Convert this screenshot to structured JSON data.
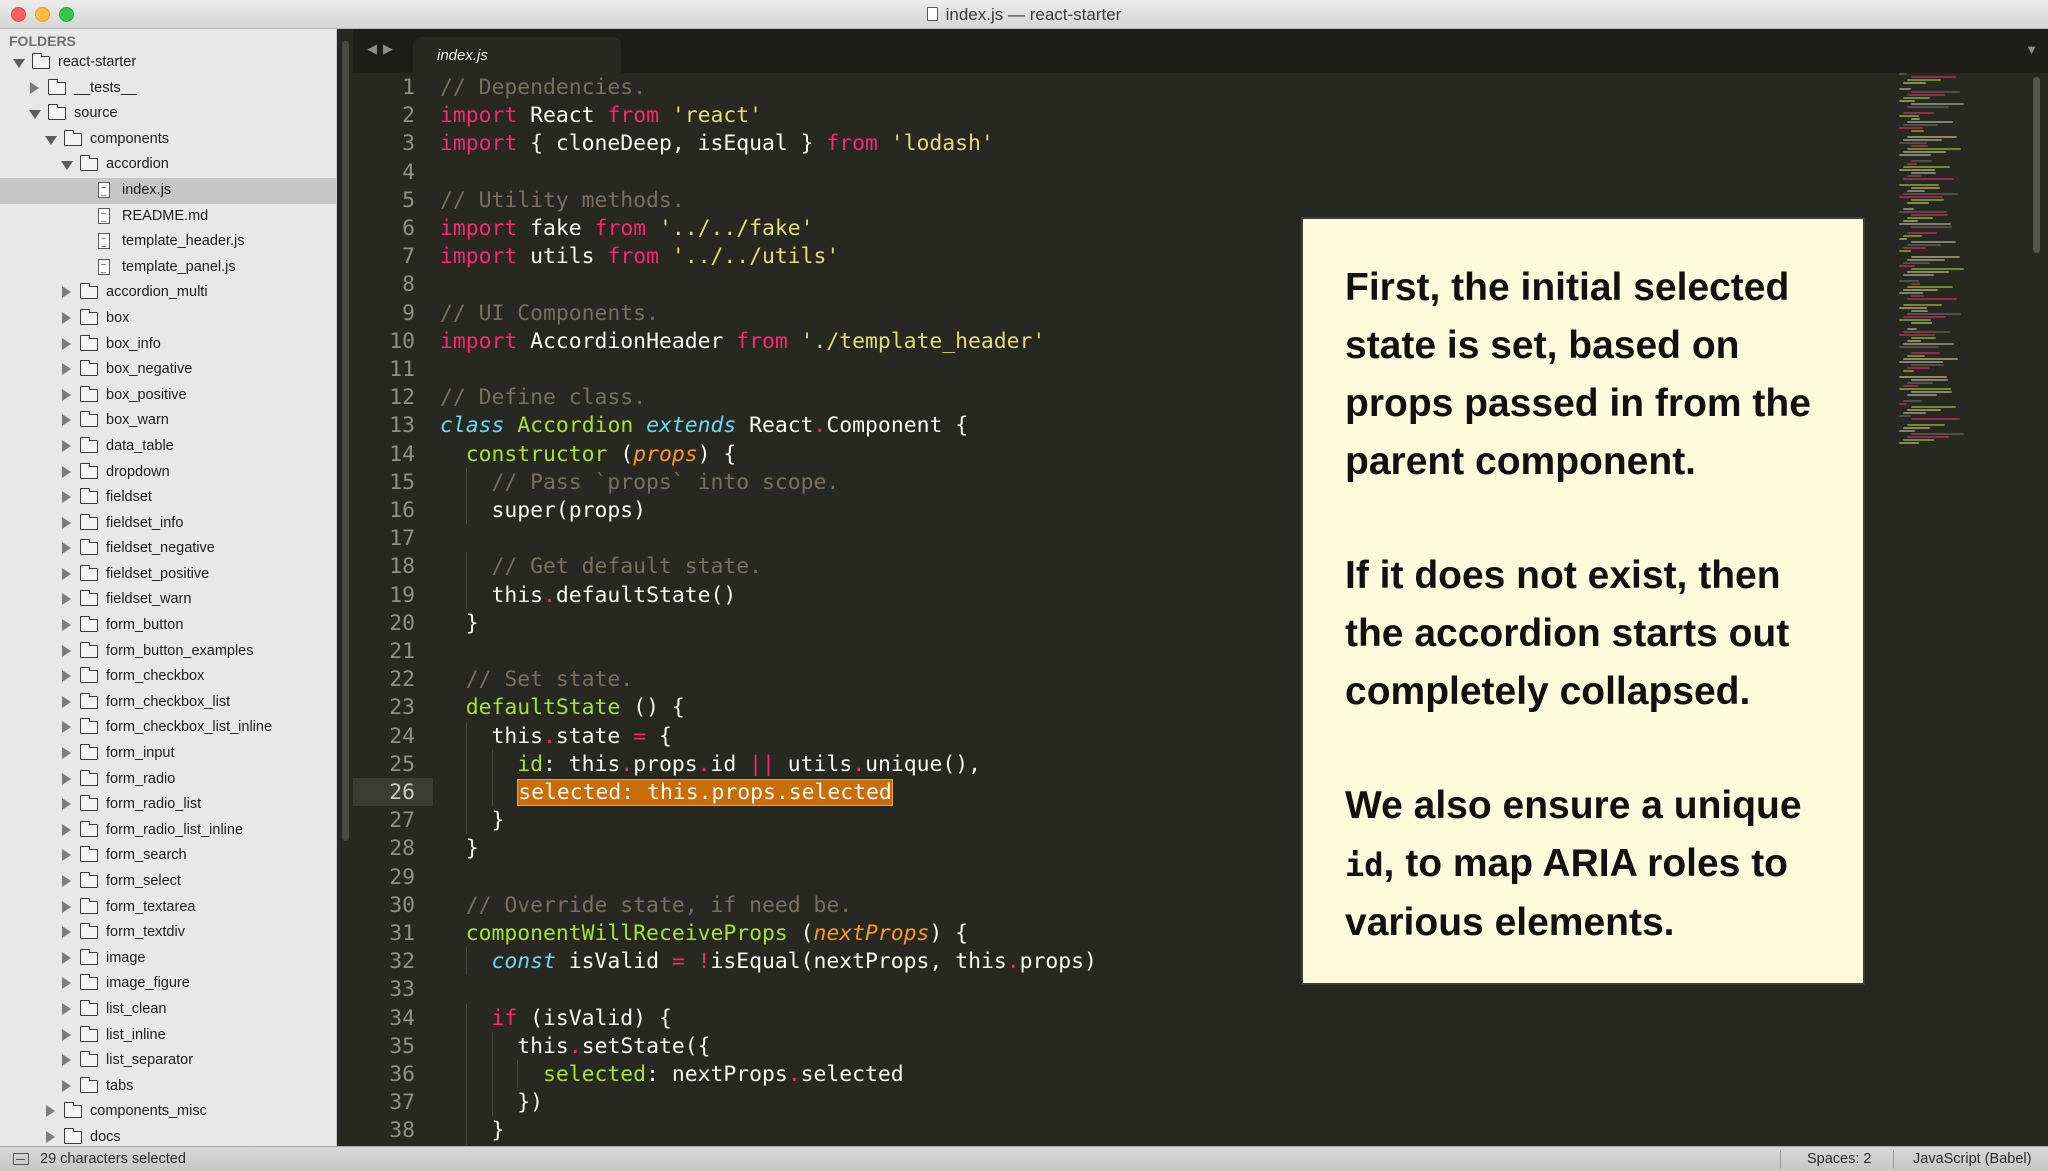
{
  "window": {
    "title": "index.js — react-starter",
    "controls": [
      "close-icon",
      "minimize-icon",
      "maximize-icon"
    ]
  },
  "sidebar": {
    "heading": "FOLDERS",
    "tree": [
      {
        "label": "react-starter",
        "depth": 0,
        "type": "folder",
        "expanded": true
      },
      {
        "label": "__tests__",
        "depth": 1,
        "type": "folder",
        "expanded": false
      },
      {
        "label": "source",
        "depth": 1,
        "type": "folder",
        "expanded": true
      },
      {
        "label": "components",
        "depth": 2,
        "type": "folder",
        "expanded": true
      },
      {
        "label": "accordion",
        "depth": 3,
        "type": "folder",
        "expanded": true
      },
      {
        "label": "index.js",
        "depth": 4,
        "type": "file",
        "selected": true
      },
      {
        "label": "README.md",
        "depth": 4,
        "type": "file"
      },
      {
        "label": "template_header.js",
        "depth": 4,
        "type": "file"
      },
      {
        "label": "template_panel.js",
        "depth": 4,
        "type": "file"
      },
      {
        "label": "accordion_multi",
        "depth": 3,
        "type": "folder",
        "expanded": false
      },
      {
        "label": "box",
        "depth": 3,
        "type": "folder",
        "expanded": false
      },
      {
        "label": "box_info",
        "depth": 3,
        "type": "folder",
        "expanded": false
      },
      {
        "label": "box_negative",
        "depth": 3,
        "type": "folder",
        "expanded": false
      },
      {
        "label": "box_positive",
        "depth": 3,
        "type": "folder",
        "expanded": false
      },
      {
        "label": "box_warn",
        "depth": 3,
        "type": "folder",
        "expanded": false
      },
      {
        "label": "data_table",
        "depth": 3,
        "type": "folder",
        "expanded": false
      },
      {
        "label": "dropdown",
        "depth": 3,
        "type": "folder",
        "expanded": false
      },
      {
        "label": "fieldset",
        "depth": 3,
        "type": "folder",
        "expanded": false
      },
      {
        "label": "fieldset_info",
        "depth": 3,
        "type": "folder",
        "expanded": false
      },
      {
        "label": "fieldset_negative",
        "depth": 3,
        "type": "folder",
        "expanded": false
      },
      {
        "label": "fieldset_positive",
        "depth": 3,
        "type": "folder",
        "expanded": false
      },
      {
        "label": "fieldset_warn",
        "depth": 3,
        "type": "folder",
        "expanded": false
      },
      {
        "label": "form_button",
        "depth": 3,
        "type": "folder",
        "expanded": false
      },
      {
        "label": "form_button_examples",
        "depth": 3,
        "type": "folder",
        "expanded": false
      },
      {
        "label": "form_checkbox",
        "depth": 3,
        "type": "folder",
        "expanded": false
      },
      {
        "label": "form_checkbox_list",
        "depth": 3,
        "type": "folder",
        "expanded": false
      },
      {
        "label": "form_checkbox_list_inline",
        "depth": 3,
        "type": "folder",
        "expanded": false
      },
      {
        "label": "form_input",
        "depth": 3,
        "type": "folder",
        "expanded": false
      },
      {
        "label": "form_radio",
        "depth": 3,
        "type": "folder",
        "expanded": false
      },
      {
        "label": "form_radio_list",
        "depth": 3,
        "type": "folder",
        "expanded": false
      },
      {
        "label": "form_radio_list_inline",
        "depth": 3,
        "type": "folder",
        "expanded": false
      },
      {
        "label": "form_search",
        "depth": 3,
        "type": "folder",
        "expanded": false
      },
      {
        "label": "form_select",
        "depth": 3,
        "type": "folder",
        "expanded": false
      },
      {
        "label": "form_textarea",
        "depth": 3,
        "type": "folder",
        "expanded": false
      },
      {
        "label": "form_textdiv",
        "depth": 3,
        "type": "folder",
        "expanded": false
      },
      {
        "label": "image",
        "depth": 3,
        "type": "folder",
        "expanded": false
      },
      {
        "label": "image_figure",
        "depth": 3,
        "type": "folder",
        "expanded": false
      },
      {
        "label": "list_clean",
        "depth": 3,
        "type": "folder",
        "expanded": false
      },
      {
        "label": "list_inline",
        "depth": 3,
        "type": "folder",
        "expanded": false
      },
      {
        "label": "list_separator",
        "depth": 3,
        "type": "folder",
        "expanded": false
      },
      {
        "label": "tabs",
        "depth": 3,
        "type": "folder",
        "expanded": false
      },
      {
        "label": "components_misc",
        "depth": 2,
        "type": "folder",
        "expanded": false
      },
      {
        "label": "docs",
        "depth": 2,
        "type": "folder",
        "expanded": false
      }
    ]
  },
  "tabs": [
    {
      "label": "index.js",
      "active": true
    }
  ],
  "editor": {
    "active_line": 26,
    "lines": [
      [
        [
          "c",
          "// Dependencies."
        ]
      ],
      [
        [
          "k",
          "import"
        ],
        [
          "p",
          " React "
        ],
        [
          "k",
          "from"
        ],
        [
          "p",
          " "
        ],
        [
          "s",
          "'react'"
        ]
      ],
      [
        [
          "k",
          "import"
        ],
        [
          "p",
          " { cloneDeep, isEqual } "
        ],
        [
          "k",
          "from"
        ],
        [
          "p",
          " "
        ],
        [
          "s",
          "'lodash'"
        ]
      ],
      [],
      [
        [
          "c",
          "// Utility methods."
        ]
      ],
      [
        [
          "k",
          "import"
        ],
        [
          "p",
          " fake "
        ],
        [
          "k",
          "from"
        ],
        [
          "p",
          " "
        ],
        [
          "s",
          "'../../fake'"
        ]
      ],
      [
        [
          "k",
          "import"
        ],
        [
          "p",
          " utils "
        ],
        [
          "k",
          "from"
        ],
        [
          "p",
          " "
        ],
        [
          "s",
          "'../../utils'"
        ]
      ],
      [],
      [
        [
          "c",
          "// UI Components."
        ]
      ],
      [
        [
          "k",
          "import"
        ],
        [
          "p",
          " AccordionHeader "
        ],
        [
          "k",
          "from"
        ],
        [
          "p",
          " "
        ],
        [
          "s",
          "'./template_header'"
        ]
      ],
      [],
      [
        [
          "c",
          "// Define class."
        ]
      ],
      [
        [
          "st",
          "class"
        ],
        [
          "p",
          " "
        ],
        [
          "cl",
          "Accordion"
        ],
        [
          "p",
          " "
        ],
        [
          "st",
          "extends"
        ],
        [
          "p",
          " React"
        ],
        [
          "o",
          "."
        ],
        [
          "p",
          "Component {"
        ]
      ],
      [
        [
          "p",
          "  "
        ],
        [
          "f",
          "constructor"
        ],
        [
          "p",
          " ("
        ],
        [
          "pa",
          "props"
        ],
        [
          "p",
          ") {"
        ]
      ],
      [
        [
          "p",
          "    "
        ],
        [
          "c",
          "// Pass `props` into scope."
        ]
      ],
      [
        [
          "p",
          "    super(props)"
        ]
      ],
      [],
      [
        [
          "p",
          "    "
        ],
        [
          "c",
          "// Get default state."
        ]
      ],
      [
        [
          "p",
          "    this"
        ],
        [
          "o",
          "."
        ],
        [
          "p",
          "defaultState()"
        ]
      ],
      [
        [
          "p",
          "  }"
        ]
      ],
      [],
      [
        [
          "p",
          "  "
        ],
        [
          "c",
          "// Set state."
        ]
      ],
      [
        [
          "p",
          "  "
        ],
        [
          "f",
          "defaultState"
        ],
        [
          "p",
          " () {"
        ]
      ],
      [
        [
          "p",
          "    this"
        ],
        [
          "o",
          "."
        ],
        [
          "p",
          "state "
        ],
        [
          "o",
          "="
        ],
        [
          "p",
          " {"
        ]
      ],
      [
        [
          "p",
          "      "
        ],
        [
          "cl",
          "id"
        ],
        [
          "p",
          ": this"
        ],
        [
          "o",
          "."
        ],
        [
          "p",
          "props"
        ],
        [
          "o",
          "."
        ],
        [
          "p",
          "id "
        ],
        [
          "o",
          "||"
        ],
        [
          "p",
          " utils"
        ],
        [
          "o",
          "."
        ],
        [
          "p",
          "unique(),"
        ]
      ],
      [
        [
          "p",
          "      "
        ],
        [
          "sel",
          "selected: this.props.selected"
        ]
      ],
      [
        [
          "p",
          "    }"
        ]
      ],
      [
        [
          "p",
          "  }"
        ]
      ],
      [],
      [
        [
          "p",
          "  "
        ],
        [
          "c",
          "// Override state, if need be."
        ]
      ],
      [
        [
          "p",
          "  "
        ],
        [
          "f",
          "componentWillReceiveProps"
        ],
        [
          "p",
          " ("
        ],
        [
          "pa",
          "nextProps"
        ],
        [
          "p",
          ") {"
        ]
      ],
      [
        [
          "p",
          "    "
        ],
        [
          "st",
          "const"
        ],
        [
          "p",
          " isValid "
        ],
        [
          "o",
          "="
        ],
        [
          "p",
          " "
        ],
        [
          "o",
          "!"
        ],
        [
          "p",
          "isEqual(nextProps, this"
        ],
        [
          "o",
          "."
        ],
        [
          "p",
          "props)"
        ]
      ],
      [],
      [
        [
          "p",
          "    "
        ],
        [
          "k",
          "if"
        ],
        [
          "p",
          " (isValid) {"
        ]
      ],
      [
        [
          "p",
          "      this"
        ],
        [
          "o",
          "."
        ],
        [
          "p",
          "setState({"
        ]
      ],
      [
        [
          "p",
          "        "
        ],
        [
          "cl",
          "selected"
        ],
        [
          "p",
          ": nextProps"
        ],
        [
          "o",
          "."
        ],
        [
          "p",
          "selected"
        ]
      ],
      [
        [
          "p",
          "      })"
        ]
      ],
      [
        [
          "p",
          "    }"
        ]
      ],
      [
        [
          "p",
          "  }"
        ]
      ]
    ]
  },
  "note": {
    "p1": "First, the initial selected state is set, based on props passed in from the parent component.",
    "p2": "If it does not exist, then the accordion starts out completely collapsed.",
    "p3_before": "We also ensure a unique ",
    "p3_code": "id",
    "p3_after": ", to map ARIA roles to various elements."
  },
  "statusbar": {
    "selection": "29 characters selected",
    "indentation": "Spaces: 2",
    "syntax": "JavaScript (Babel)"
  },
  "colors": {
    "background": "#272822",
    "comment": "#75715e",
    "keyword": "#f92672",
    "string": "#e6db74",
    "storage": "#66d9ef",
    "function": "#a6e22e",
    "parameter": "#fd971f",
    "selection": "#c96d0a"
  }
}
